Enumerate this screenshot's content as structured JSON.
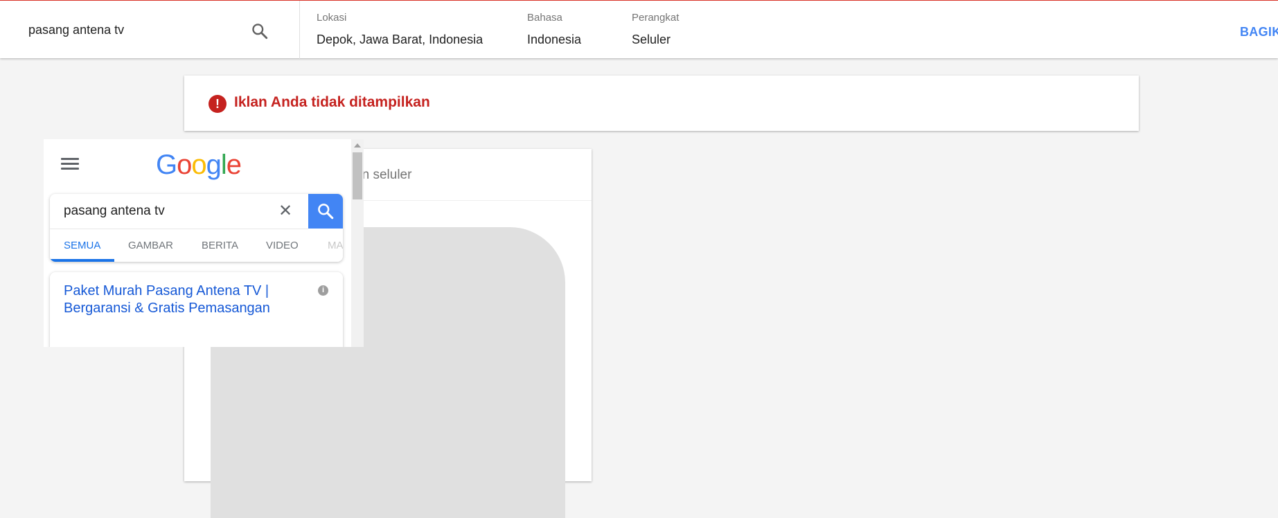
{
  "topbar": {
    "query": "pasang antena tv",
    "params": [
      {
        "label": "Lokasi",
        "value": "Depok, Jawa Barat, Indonesia"
      },
      {
        "label": "Bahasa",
        "value": "Indonesia"
      },
      {
        "label": "Perangkat",
        "value": "Seluler"
      }
    ],
    "share_label": "BAGIKAN"
  },
  "alert": {
    "icon": "error-icon",
    "text": "Iklan Anda tidak ditampilkan"
  },
  "preview": {
    "title": "Pratinjau hasil penelusuran seluler",
    "google_logo": "Google",
    "search_query": "pasang antena tv",
    "tabs": [
      "SEMUA",
      "GAMBAR",
      "BERITA",
      "VIDEO",
      "MA"
    ],
    "active_tab": "SEMUA",
    "result": {
      "title": "Paket Murah Pasang Antena TV | Bergaransi & Gratis Pemasangan",
      "description": ""
    }
  },
  "colors": {
    "accent": "#4285f4",
    "error": "#c5221f",
    "link": "#1558d6"
  }
}
